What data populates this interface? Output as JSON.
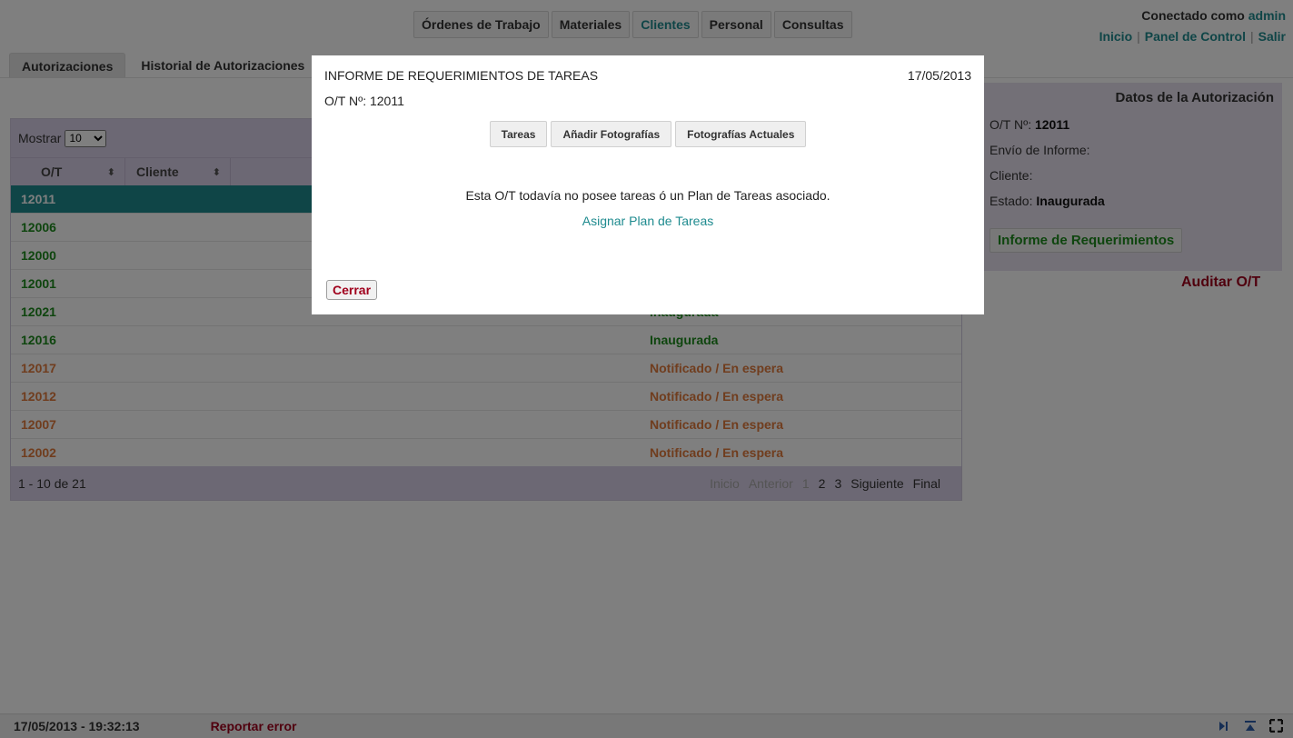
{
  "nav": {
    "tabs": [
      {
        "label": "Órdenes de Trabajo"
      },
      {
        "label": "Materiales"
      },
      {
        "label": "Clientes"
      },
      {
        "label": "Personal"
      },
      {
        "label": "Consultas"
      }
    ],
    "active_tab": "Clientes"
  },
  "user": {
    "connected_prefix": "Conectado como",
    "username": "admin",
    "links": [
      "Inicio",
      "Panel de Control",
      "Salir"
    ],
    "separator": "|"
  },
  "subtabs": [
    {
      "label": "Autorizaciones"
    },
    {
      "label": "Historial de Autorizaciones"
    }
  ],
  "table": {
    "show_label": "Mostrar",
    "page_size": "10",
    "columns": [
      "O/T",
      "Cliente"
    ],
    "sort_icon": "⬍",
    "rows": [
      {
        "ot": "12011",
        "estado": "",
        "style": "sel"
      },
      {
        "ot": "12006",
        "estado": "",
        "style": "g"
      },
      {
        "ot": "12000",
        "estado": "",
        "style": "g"
      },
      {
        "ot": "12001",
        "estado": "",
        "style": "g"
      },
      {
        "ot": "12021",
        "estado": "Inaugurada",
        "style": "g"
      },
      {
        "ot": "12016",
        "estado": "Inaugurada",
        "style": "g"
      },
      {
        "ot": "12017",
        "estado": "Notificado / En espera",
        "style": "o"
      },
      {
        "ot": "12012",
        "estado": "Notificado / En espera",
        "style": "o"
      },
      {
        "ot": "12007",
        "estado": "Notificado / En espera",
        "style": "o"
      },
      {
        "ot": "12002",
        "estado": "Notificado / En espera",
        "style": "o"
      }
    ],
    "range": "1 - 10 de 21",
    "pager": {
      "first": "Inicio",
      "prev": "Anterior",
      "pages": [
        "1",
        "2",
        "3"
      ],
      "next": "Siguiente",
      "last": "Final"
    }
  },
  "details": {
    "title": "Datos de la Autorización",
    "ot_label": "O/T Nº:",
    "ot_value": "12011",
    "envio_label": "Envío de Informe:",
    "cliente_label": "Cliente:",
    "estado_label": "Estado:",
    "estado_value": "Inaugurada",
    "report_button": "Informe de Requerimientos",
    "audit_link": "Auditar O/T"
  },
  "footer": {
    "datetime": "17/05/2013 - 19:32:13",
    "report_error": "Reportar error"
  },
  "modal": {
    "title": "INFORME DE REQUERIMIENTOS DE TAREAS",
    "date": "17/05/2013",
    "ot_line": "O/T Nº: 12011",
    "buttons": [
      "Tareas",
      "Añadir Fotografías",
      "Fotografías Actuales"
    ],
    "message": "Esta O/T todavía no posee tareas ó un Plan de Tareas asociado.",
    "link": "Asignar Plan de Tareas",
    "close": "Cerrar"
  },
  "colors": {
    "teal_accent": "#1f8b8f",
    "green_status": "#1c8a1c",
    "orange_status": "#e07a3c",
    "red_link": "#a0001c",
    "panel_purple": "#d9d1e8"
  }
}
